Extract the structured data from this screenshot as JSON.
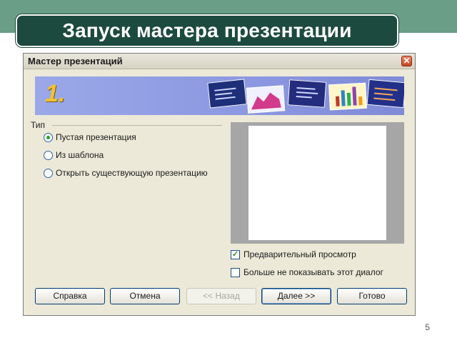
{
  "slide": {
    "title": "Запуск мастера презентации",
    "page_number": "5",
    "colors": {
      "header_band": "#6a9e86",
      "title_box": "#1d4a3e"
    }
  },
  "dialog": {
    "title": "Мастер презентаций",
    "close_icon": "close-icon",
    "banner": {
      "step": "1."
    },
    "type_group": {
      "label": "Тип",
      "options": [
        {
          "label": "Пустая презентация",
          "selected": true
        },
        {
          "label": "Из шаблона",
          "selected": false
        },
        {
          "label": "Открыть существующую презентацию",
          "selected": false
        }
      ]
    },
    "checkboxes": [
      {
        "label": "Предварительный просмотр",
        "checked": true
      },
      {
        "label": "Больше не показывать этот диалог",
        "checked": false
      }
    ],
    "buttons": {
      "help": "Справка",
      "cancel": "Отмена",
      "back": "<< Назад",
      "next": "Далее >>",
      "finish": "Готово"
    }
  }
}
